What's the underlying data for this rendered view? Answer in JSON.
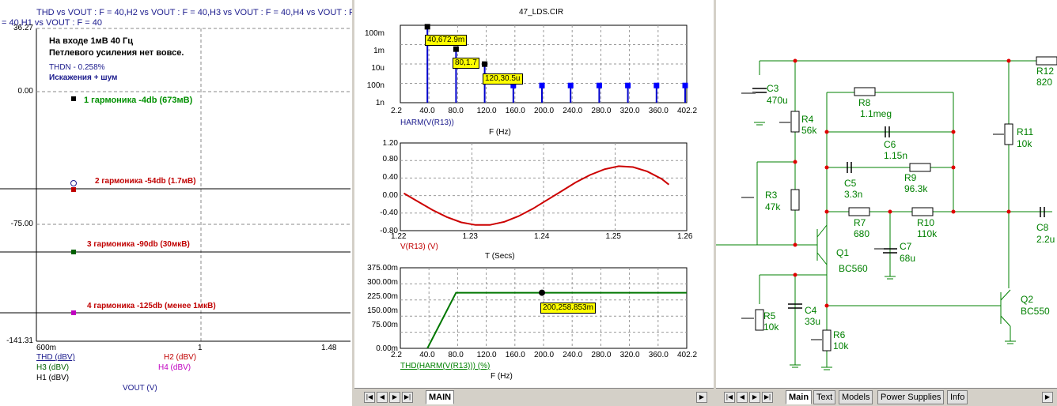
{
  "left": {
    "header_line1": "THD vs VOUT : F = 40,H2 vs VOUT : F = 40,H3 vs VOUT : F = 40,H4 vs VOUT : F =",
    "header_line2": "= 40,H1 vs VOUT : F = 40",
    "y_ticks": [
      "36.27",
      "0.00",
      "-75.00",
      "-141.31"
    ],
    "x_ticks": [
      "600m",
      "1",
      "1.48"
    ],
    "note_line1": "На входе 1мВ  40 Гц",
    "note_line2": "Петлевого усиления нет вовсе.",
    "thdn": "THDN - 0.258%",
    "noise": "Искажения + шум",
    "annotations": {
      "h1": "1 гармоника -4db (673мВ)",
      "h2": "2 гармоника -54db (1.7мВ)",
      "h3": "3 гармоника -90db (30мкВ)",
      "h4": "4 гармоника -125db (менее 1мкВ)"
    },
    "legend": {
      "thd": "THD (dBV)",
      "h2": "H2 (dBV)",
      "h3": "H3 (dBV)",
      "h4": "H4 (dBV)",
      "h1": "H1 (dBV)"
    },
    "xlabel": "VOUT (V)",
    "colors": {
      "thd": "#1a1a8c",
      "h1": "#000000",
      "h2": "#c00000",
      "h3": "#006000",
      "h4": "#c000c0",
      "anno_h1": "#009000",
      "anno_other": "#c00000"
    }
  },
  "middle": {
    "title": "47_LDS.CIR",
    "harm": {
      "y_ticks": [
        "100m",
        "1m",
        "10u",
        "100n",
        "1n"
      ],
      "x_ticks": [
        "2.2",
        "40.0",
        "80.0",
        "120.0",
        "160.0",
        "200.0",
        "240.0",
        "280.0",
        "320.0",
        "360.0",
        "402.2"
      ],
      "series_label": "HARM(V(R13))",
      "xlabel": "F (Hz)",
      "flags": [
        "40,672.9m",
        "80,1.7",
        "120,30.5u"
      ]
    },
    "tran": {
      "y_ticks": [
        "1.20",
        "0.80",
        "0.40",
        "0.00",
        "-0.40",
        "-0.80"
      ],
      "x_ticks": [
        "1.22",
        "1.23",
        "1.24",
        "1.25",
        "1.26"
      ],
      "series_label": "V(R13) (V)",
      "xlabel": "T (Secs)"
    },
    "thd": {
      "y_ticks": [
        "375.00m",
        "300.00m",
        "225.00m",
        "150.00m",
        "75.00m",
        "0.00m"
      ],
      "x_ticks": [
        "2.2",
        "40.0",
        "80.0",
        "120.0",
        "160.0",
        "200.0",
        "240.0",
        "280.0",
        "320.0",
        "360.0",
        "402.2"
      ],
      "series_label": "THD(HARM(V(R13))) (%)",
      "xlabel": "F (Hz)",
      "flag": "200,258.853m"
    },
    "tab_label": "MAIN"
  },
  "chart_data": [
    {
      "type": "bar",
      "x": [
        40,
        80,
        120,
        160,
        200,
        240,
        280,
        320,
        360,
        400
      ],
      "values": [
        0.673,
        0.0017,
        3.05e-05,
        1e-07,
        1e-07,
        1e-07,
        1e-07,
        1e-07,
        1e-07,
        1e-07
      ],
      "xlim": [
        2.2,
        402.2
      ],
      "ylim": [
        1e-09,
        1
      ],
      "yscale": "log",
      "xlabel": "F (Hz)",
      "ylabel": "HARM(V(R13))"
    },
    {
      "type": "line",
      "x": [
        1.2205,
        1.2225,
        1.2245,
        1.2265,
        1.2285,
        1.2305,
        1.2325,
        1.2345,
        1.2365,
        1.2385,
        1.2405,
        1.2425,
        1.2445,
        1.2465,
        1.2485,
        1.2505,
        1.2525,
        1.2545,
        1.2565,
        1.2575
      ],
      "values": [
        0.05,
        -0.14,
        -0.33,
        -0.49,
        -0.61,
        -0.67,
        -0.67,
        -0.6,
        -0.47,
        -0.3,
        -0.1,
        0.1,
        0.3,
        0.47,
        0.6,
        0.67,
        0.65,
        0.55,
        0.38,
        0.25
      ],
      "xlim": [
        1.22,
        1.26
      ],
      "ylim": [
        -0.8,
        1.2
      ],
      "xlabel": "T (Secs)",
      "ylabel": "V(R13) (V)"
    },
    {
      "type": "line",
      "x": [
        40,
        80,
        402.2
      ],
      "values": [
        0,
        0.258853,
        0.258853
      ],
      "xlim": [
        2.2,
        402.2
      ],
      "ylim": [
        0,
        0.375
      ],
      "xlabel": "F (Hz)",
      "ylabel": "THD(HARM(V(R13))) (%)"
    }
  ],
  "right": {
    "components": {
      "r12": "R12",
      "r12v": "820",
      "c3": "C3",
      "c3v": "470u",
      "r8": "R8",
      "r8v": "1.1meg",
      "r4": "R4",
      "r4v": "56k",
      "c6": "C6",
      "c6v": "1.15n",
      "r11": "R11",
      "r11v": "10k",
      "c5": "C5",
      "c5v": "3.3n",
      "r9": "R9",
      "r9v": "96.3k",
      "r3": "R3",
      "r3v": "47k",
      "r7": "R7",
      "r7v": "680",
      "r10": "R10",
      "r10v": "110k",
      "c8": "C8",
      "c8v": "2.2u",
      "q1": "Q1",
      "q1v": "BC560",
      "c7": "C7",
      "c7v": "68u",
      "q2": "Q2",
      "q2v": "BC550",
      "c4": "C4",
      "c4v": "33u",
      "r5": "R5",
      "r5v": "10k",
      "r6": "R6",
      "r6v": "10k"
    },
    "tabs": [
      "Main",
      "Text",
      "Models",
      "Power Supplies",
      "Info"
    ]
  }
}
